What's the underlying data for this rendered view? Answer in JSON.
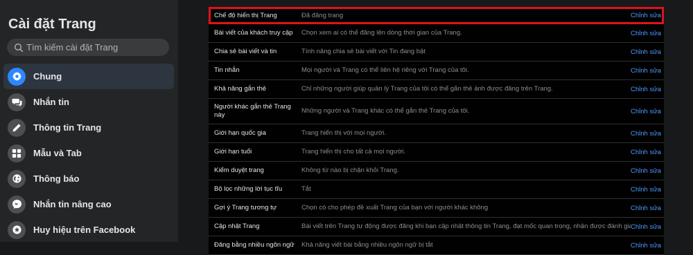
{
  "sidebar": {
    "title": "Cài đặt Trang",
    "search_placeholder": "Tìm kiếm cài đặt Trang",
    "items": [
      {
        "label": "Chung",
        "icon": "gear-icon",
        "active": true
      },
      {
        "label": "Nhắn tin",
        "icon": "chat-icon",
        "active": false
      },
      {
        "label": "Thông tin Trang",
        "icon": "pencil-icon",
        "active": false
      },
      {
        "label": "Mẫu và Tab",
        "icon": "grid-icon",
        "active": false
      },
      {
        "label": "Thông báo",
        "icon": "globe-icon",
        "active": false
      },
      {
        "label": "Nhắn tin nâng cao",
        "icon": "messenger-icon",
        "active": false
      },
      {
        "label": "Huy hiệu trên Facebook",
        "icon": "badge-icon",
        "active": false
      }
    ]
  },
  "settings": {
    "edit_label": "Chỉnh sửa",
    "rows": [
      {
        "name": "Chế độ hiển thị Trang",
        "value": "Đã đăng trang",
        "highlight": true
      },
      {
        "name": "Bài viết của khách truy cập",
        "value": "Chọn xem ai có thể đăng lên dòng thời gian của Trang."
      },
      {
        "name": "Chia sẻ bài viết và tin",
        "value": "Tính năng chia sẻ bài viết với Tin đang bật"
      },
      {
        "name": "Tin nhắn",
        "value": "Mọi người và Trang có thể liên hệ riêng với Trang của tôi."
      },
      {
        "name": "Khả năng gắn thẻ",
        "value": "Chỉ những người giúp quản lý Trang của tôi có thể gắn thẻ ảnh được đăng trên Trang."
      },
      {
        "name": "Người khác gắn thẻ Trang này",
        "value": "Những người và Trang khác có thể gắn thẻ Trang của tôi."
      },
      {
        "name": "Giới hạn quốc gia",
        "value": "Trang hiển thị với mọi người."
      },
      {
        "name": "Giới hạn tuổi",
        "value": "Trang hiển thị cho tất cả mọi người."
      },
      {
        "name": "Kiểm duyệt trang",
        "value": "Không từ nào bị chặn khỏi Trang."
      },
      {
        "name": "Bộ lọc những lời tục tĩu",
        "value": "Tắt"
      },
      {
        "name": "Gợi ý Trang tương tự",
        "value": "Chọn có cho phép đề xuất Trang của bạn với người khác không"
      },
      {
        "name": "Cập nhật Trang",
        "value": "Bài viết trên Trang tự động được đăng khi bạn cập nhật thông tin Trang, đạt mốc quan trọng, nhận được đánh giá và v.v."
      },
      {
        "name": "Đăng bằng nhiều ngôn ngữ",
        "value": "Khả năng viết bài bằng nhiều ngôn ngữ bị tắt"
      }
    ]
  },
  "colors": {
    "accent": "#2d88ff",
    "link": "#4f9bff",
    "highlight_border": "#e0121b"
  }
}
